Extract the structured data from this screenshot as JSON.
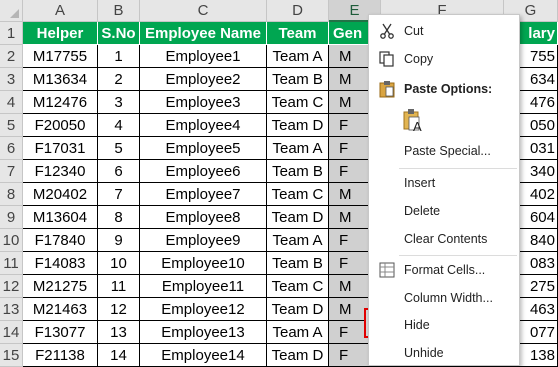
{
  "columns": [
    "A",
    "B",
    "C",
    "D",
    "E",
    "F",
    "G"
  ],
  "rows": [
    "1",
    "2",
    "3",
    "4",
    "5",
    "6",
    "7",
    "8",
    "9",
    "10",
    "11",
    "12",
    "13",
    "14",
    "15"
  ],
  "headers": {
    "helper": "Helper",
    "sno": "S.No",
    "name": "Employee Name",
    "team": "Team",
    "gender_partial": "Gen",
    "salary_partial": "lary"
  },
  "data_rows": [
    {
      "helper": "M17755",
      "sno": "1",
      "name": "Employee1",
      "team": "Team A",
      "gender": "M",
      "salary": "755"
    },
    {
      "helper": "M13634",
      "sno": "2",
      "name": "Employee2",
      "team": "Team B",
      "gender": "M",
      "salary": "634"
    },
    {
      "helper": "M12476",
      "sno": "3",
      "name": "Employee3",
      "team": "Team C",
      "gender": "M",
      "salary": "476"
    },
    {
      "helper": "F20050",
      "sno": "4",
      "name": "Employee4",
      "team": "Team D",
      "gender": "F",
      "salary": "050"
    },
    {
      "helper": "F17031",
      "sno": "5",
      "name": "Employee5",
      "team": "Team A",
      "gender": "F",
      "salary": "031"
    },
    {
      "helper": "F12340",
      "sno": "6",
      "name": "Employee6",
      "team": "Team B",
      "gender": "F",
      "salary": "340"
    },
    {
      "helper": "M20402",
      "sno": "7",
      "name": "Employee7",
      "team": "Team C",
      "gender": "M",
      "salary": "402"
    },
    {
      "helper": "M13604",
      "sno": "8",
      "name": "Employee8",
      "team": "Team D",
      "gender": "M",
      "salary": "604"
    },
    {
      "helper": "F17840",
      "sno": "9",
      "name": "Employee9",
      "team": "Team A",
      "gender": "F",
      "salary": "840"
    },
    {
      "helper": "F14083",
      "sno": "10",
      "name": "Employee10",
      "team": "Team B",
      "gender": "F",
      "salary": "083"
    },
    {
      "helper": "M21275",
      "sno": "11",
      "name": "Employee11",
      "team": "Team C",
      "gender": "M",
      "salary": "275"
    },
    {
      "helper": "M21463",
      "sno": "12",
      "name": "Employee12",
      "team": "Team D",
      "gender": "M",
      "salary": "463"
    },
    {
      "helper": "F13077",
      "sno": "13",
      "name": "Employee13",
      "team": "Team A",
      "gender": "F",
      "salary": "077"
    },
    {
      "helper": "F21138",
      "sno": "14",
      "name": "Employee14",
      "team": "Team D",
      "gender": "F",
      "salary": "138"
    }
  ],
  "context_menu": {
    "cut": "Cut",
    "copy": "Copy",
    "paste_options": "Paste Options:",
    "paste_special": "Paste Special...",
    "insert": "Insert",
    "delete": "Delete",
    "clear_contents": "Clear Contents",
    "format_cells": "Format Cells...",
    "column_width": "Column Width...",
    "hide": "Hide",
    "unhide": "Unhide"
  },
  "colors": {
    "header_fill": "#00a651",
    "selected_column": "#d0d0d0",
    "highlight_border": "#e00000"
  }
}
